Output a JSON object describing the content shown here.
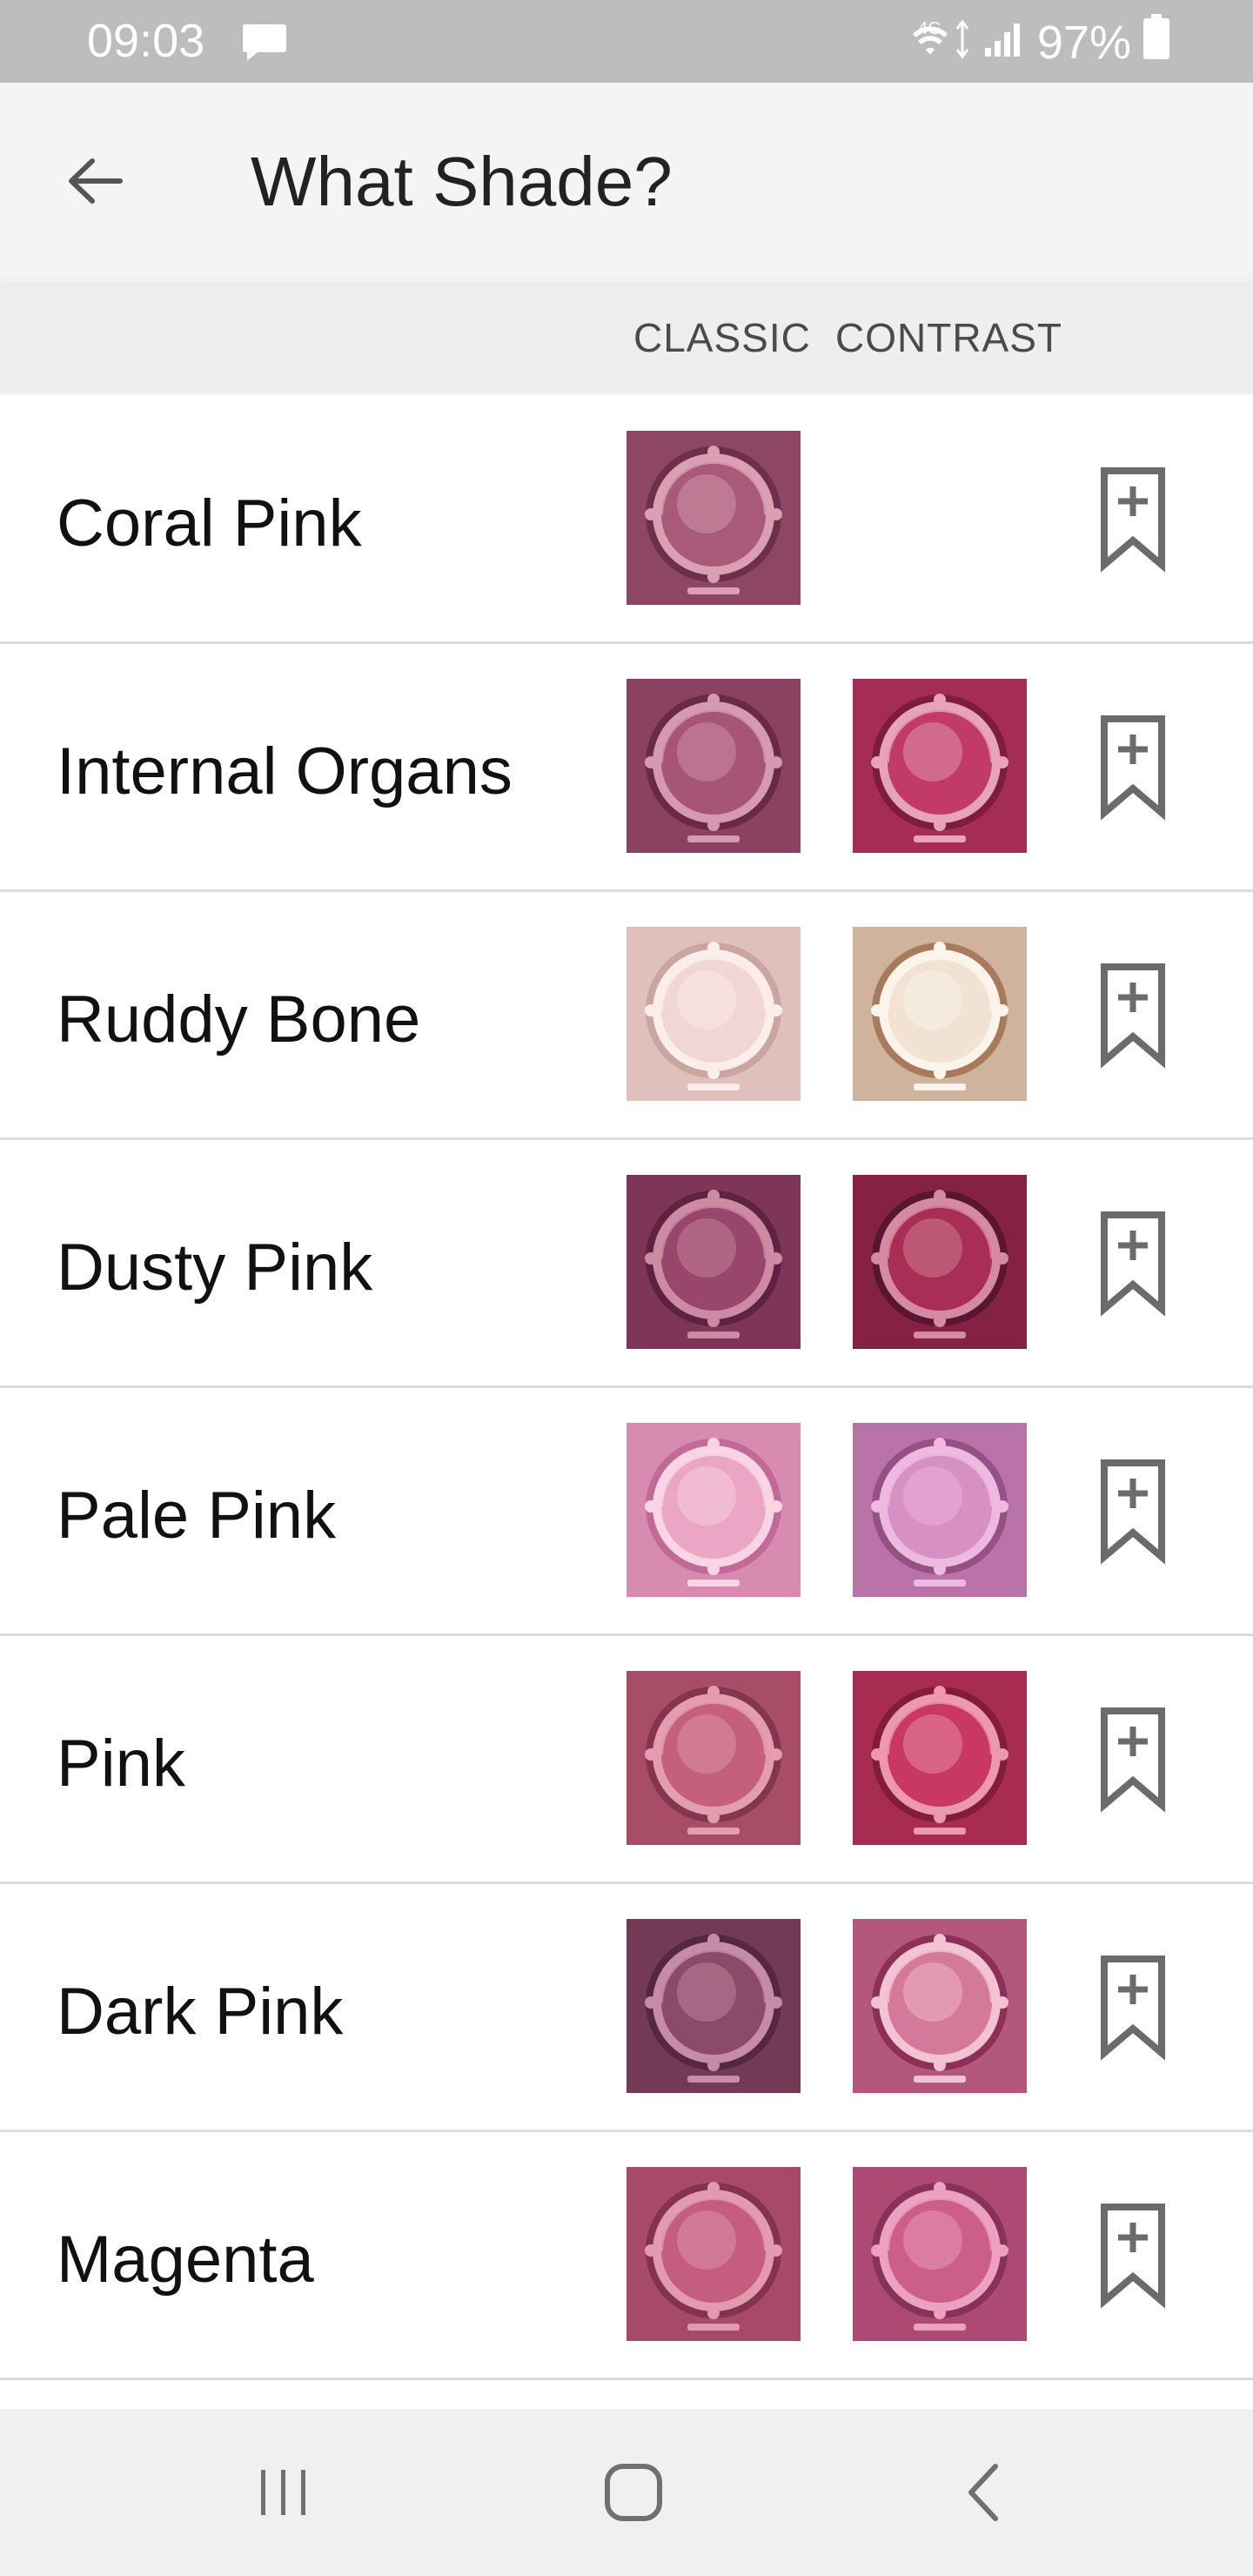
{
  "status": {
    "time": "09:03",
    "network": "4G",
    "battery": "97%"
  },
  "app_bar": {
    "title": "What Shade?",
    "back_icon": "arrow-left-icon"
  },
  "columns": {
    "classic": "CLASSIC",
    "contrast": "CONTRAST"
  },
  "shades": [
    {
      "name": "Coral Pink",
      "classic": {
        "base": "#a85a78",
        "dark": "#6e2f4a",
        "light": "#d99fb3"
      },
      "contrast": null
    },
    {
      "name": "Internal Organs",
      "classic": {
        "base": "#a65576",
        "dark": "#6a2945",
        "light": "#d59ab1"
      },
      "contrast": {
        "base": "#c23a6a",
        "dark": "#7e1c40",
        "light": "#e7a3bb"
      }
    },
    {
      "name": "Ruddy Bone",
      "classic": {
        "base": "#f0d6d4",
        "dark": "#c9a6a0",
        "light": "#fbeeea"
      },
      "contrast": {
        "base": "#f1e2d4",
        "dark": "#a77a5b",
        "light": "#fbf4ea"
      }
    },
    {
      "name": "Dusty Pink",
      "classic": {
        "base": "#98466b",
        "dark": "#5e2340",
        "light": "#cc8aa5"
      },
      "contrast": {
        "base": "#a92e55",
        "dark": "#5a1630",
        "light": "#d48aa0"
      }
    },
    {
      "name": "Pale Pink",
      "classic": {
        "base": "#eba6c5",
        "dark": "#c16a97",
        "light": "#f8d4e4"
      },
      "contrast": {
        "base": "#d790c4",
        "dark": "#955086",
        "light": "#eeb9de"
      }
    },
    {
      "name": "Pink",
      "classic": {
        "base": "#c4607e",
        "dark": "#84354f",
        "light": "#e39cb0"
      },
      "contrast": {
        "base": "#c83862",
        "dark": "#821c3c",
        "light": "#eb98b0"
      }
    },
    {
      "name": "Dark Pink",
      "classic": {
        "base": "#8c4a6b",
        "dark": "#552742",
        "light": "#c58ba7"
      },
      "contrast": {
        "base": "#d4799a",
        "dark": "#8d3057",
        "light": "#f3c3d2"
      }
    },
    {
      "name": "Magenta",
      "classic": {
        "base": "#c45d7f",
        "dark": "#84334f",
        "light": "#e39ab1"
      },
      "contrast": {
        "base": "#cc5f89",
        "dark": "#86325a",
        "light": "#eba1bf"
      }
    }
  ],
  "bookmark_icon": "bookmark-add-icon",
  "nav": {
    "recents_icon": "recents-icon",
    "home_icon": "home-icon",
    "back_icon": "nav-back-icon"
  }
}
